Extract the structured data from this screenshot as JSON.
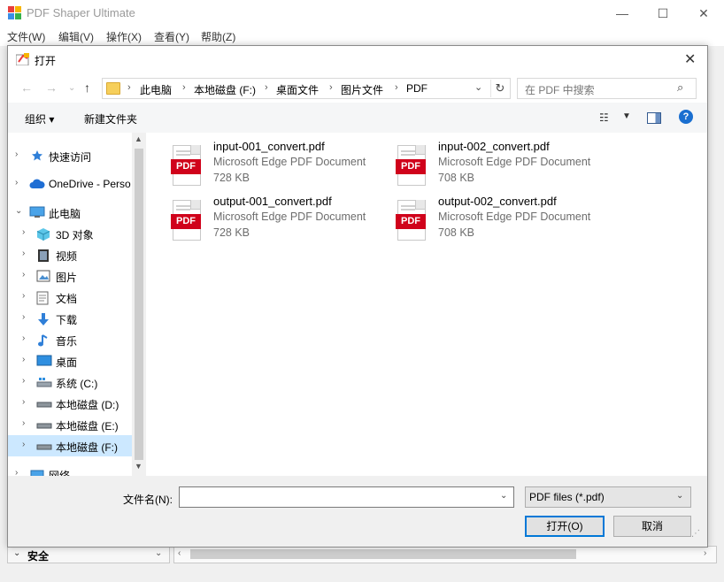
{
  "app": {
    "title": "PDF Shaper Ultimate",
    "menu": [
      "文件(W)",
      "编辑(V)",
      "操作(X)",
      "查看(Y)",
      "帮助(Z)"
    ],
    "window_controls": [
      "—",
      "☐",
      "✕"
    ],
    "bottom": {
      "section_label": "安全"
    }
  },
  "dialog": {
    "title": "打开",
    "breadcrumb": [
      "此电脑",
      "本地磁盘 (F:)",
      "桌面文件",
      "图片文件",
      "PDF"
    ],
    "search_placeholder": "在 PDF 中搜索",
    "toolbar": {
      "organize": "组织 ▾",
      "new_folder": "新建文件夹"
    },
    "nav_items": [
      {
        "label": "快速访问",
        "icon": "star-icon"
      },
      {
        "label": "OneDrive - Perso",
        "icon": "cloud-icon"
      },
      {
        "label": "此电脑",
        "icon": "computer-icon",
        "expanded": true
      },
      {
        "label": "3D 对象",
        "icon": "cube-icon"
      },
      {
        "label": "视频",
        "icon": "video-icon"
      },
      {
        "label": "图片",
        "icon": "picture-icon"
      },
      {
        "label": "文档",
        "icon": "document-icon"
      },
      {
        "label": "下载",
        "icon": "download-icon"
      },
      {
        "label": "音乐",
        "icon": "music-icon"
      },
      {
        "label": "桌面",
        "icon": "desktop-icon"
      },
      {
        "label": "系统 (C:)",
        "icon": "system-drive-icon"
      },
      {
        "label": "本地磁盘 (D:)",
        "icon": "drive-icon"
      },
      {
        "label": "本地磁盘 (E:)",
        "icon": "drive-icon"
      },
      {
        "label": "本地磁盘 (F:)",
        "icon": "drive-icon",
        "selected": true
      },
      {
        "label": "网络",
        "icon": "network-icon"
      }
    ],
    "files": [
      {
        "name": "input-001_convert.pdf",
        "type": "Microsoft Edge PDF Document",
        "size": "728 KB",
        "icon_label": "PDF"
      },
      {
        "name": "input-002_convert.pdf",
        "type": "Microsoft Edge PDF Document",
        "size": "708 KB",
        "icon_label": "PDF"
      },
      {
        "name": "output-001_convert.pdf",
        "type": "Microsoft Edge PDF Document",
        "size": "728 KB",
        "icon_label": "PDF"
      },
      {
        "name": "output-002_convert.pdf",
        "type": "Microsoft Edge PDF Document",
        "size": "708 KB",
        "icon_label": "PDF"
      }
    ],
    "filename_label": "文件名(N):",
    "filename_value": "",
    "filetype_value": "PDF files (*.pdf)",
    "open_button": "打开(O)",
    "cancel_button": "取消"
  },
  "colors": {
    "accent": "#0078d7",
    "pdf_red": "#d0021b",
    "selection": "#cce8ff"
  }
}
